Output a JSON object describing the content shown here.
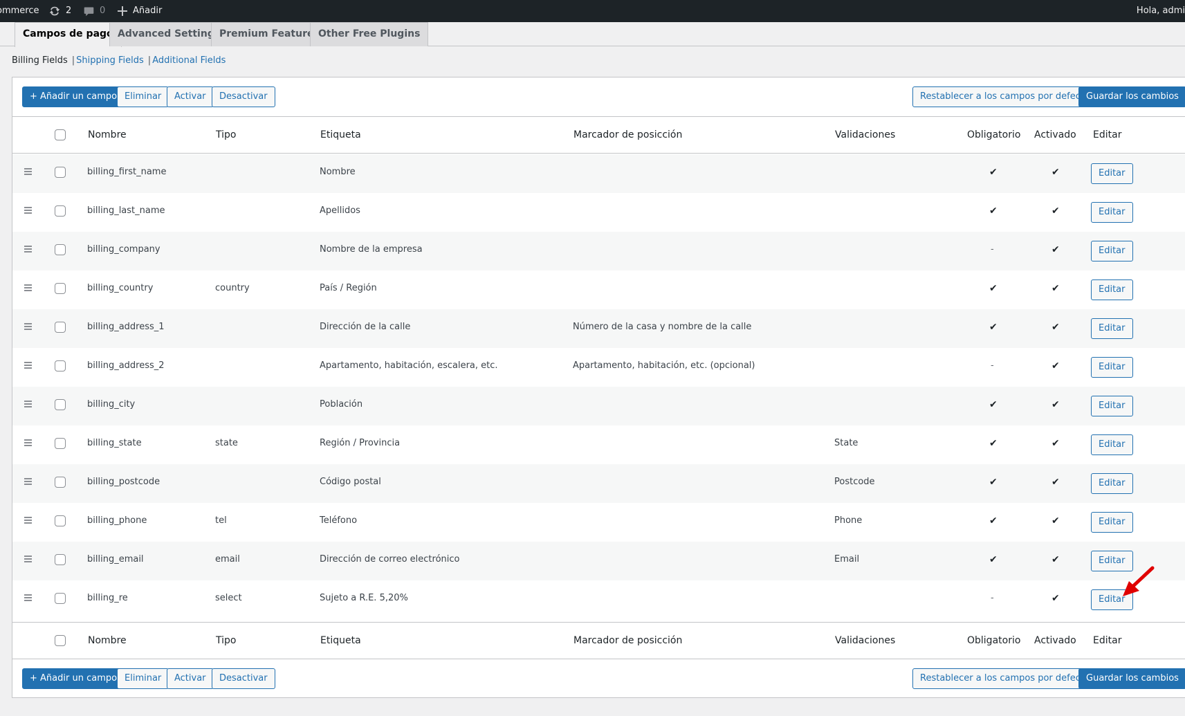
{
  "admin_bar": {
    "site_name": "ommerce",
    "updates_count": "2",
    "comments_count": "0",
    "new_label": "Añadir",
    "greeting": "Hola, admi"
  },
  "tabs": [
    {
      "label": "Campos de pago",
      "active": true
    },
    {
      "label": "Advanced Settings",
      "active": false
    },
    {
      "label": "Premium Features",
      "active": false
    },
    {
      "label": "Other Free Plugins",
      "active": false
    }
  ],
  "subnav": {
    "current": "Billing Fields",
    "links": [
      "Shipping Fields",
      "Additional Fields"
    ],
    "separator": "|"
  },
  "toolbar": {
    "add_field": "+ Añadir un campo",
    "delete": "Eliminar",
    "activate": "Activar",
    "deactivate": "Desactivar",
    "reset": "Restablecer a los campos por defecto",
    "save": "Guardar los cambios"
  },
  "columns": {
    "name": "Nombre",
    "type": "Tipo",
    "label": "Etiqueta",
    "placeholder": "Marcador de posicción",
    "validations": "Validaciones",
    "required": "Obligatorio",
    "enabled": "Activado",
    "edit": "Editar"
  },
  "rows": [
    {
      "name": "billing_first_name",
      "type": "",
      "label": "Nombre",
      "placeholder": "",
      "validations": "",
      "required": true,
      "enabled": true,
      "edit": "Editar"
    },
    {
      "name": "billing_last_name",
      "type": "",
      "label": "Apellidos",
      "placeholder": "",
      "validations": "",
      "required": true,
      "enabled": true,
      "edit": "Editar"
    },
    {
      "name": "billing_company",
      "type": "",
      "label": "Nombre de la empresa",
      "placeholder": "",
      "validations": "",
      "required": false,
      "enabled": true,
      "edit": "Editar"
    },
    {
      "name": "billing_country",
      "type": "country",
      "label": "País / Región",
      "placeholder": "",
      "validations": "",
      "required": true,
      "enabled": true,
      "edit": "Editar"
    },
    {
      "name": "billing_address_1",
      "type": "",
      "label": "Dirección de la calle",
      "placeholder": "Número de la casa y nombre de la calle",
      "validations": "",
      "required": true,
      "enabled": true,
      "edit": "Editar"
    },
    {
      "name": "billing_address_2",
      "type": "",
      "label": "Apartamento, habitación, escalera, etc.",
      "placeholder": "Apartamento, habitación, etc. (opcional)",
      "validations": "",
      "required": false,
      "enabled": true,
      "edit": "Editar"
    },
    {
      "name": "billing_city",
      "type": "",
      "label": "Población",
      "placeholder": "",
      "validations": "",
      "required": true,
      "enabled": true,
      "edit": "Editar"
    },
    {
      "name": "billing_state",
      "type": "state",
      "label": "Región / Provincia",
      "placeholder": "",
      "validations": "State",
      "required": true,
      "enabled": true,
      "edit": "Editar"
    },
    {
      "name": "billing_postcode",
      "type": "",
      "label": "Código postal",
      "placeholder": "",
      "validations": "Postcode",
      "required": true,
      "enabled": true,
      "edit": "Editar"
    },
    {
      "name": "billing_phone",
      "type": "tel",
      "label": "Teléfono",
      "placeholder": "",
      "validations": "Phone",
      "required": true,
      "enabled": true,
      "edit": "Editar"
    },
    {
      "name": "billing_email",
      "type": "email",
      "label": "Dirección de correo electrónico",
      "placeholder": "",
      "validations": "Email",
      "required": true,
      "enabled": true,
      "edit": "Editar"
    },
    {
      "name": "billing_re",
      "type": "select",
      "label": "Sujeto a R.E. 5,20%",
      "placeholder": "",
      "validations": "",
      "required": false,
      "enabled": true,
      "edit": "Editar"
    }
  ],
  "symbols": {
    "check": "✔",
    "dash": "-"
  },
  "colors": {
    "primary": "#2271b1",
    "admin_bar": "#1d2327",
    "arrow": "#e00000"
  }
}
